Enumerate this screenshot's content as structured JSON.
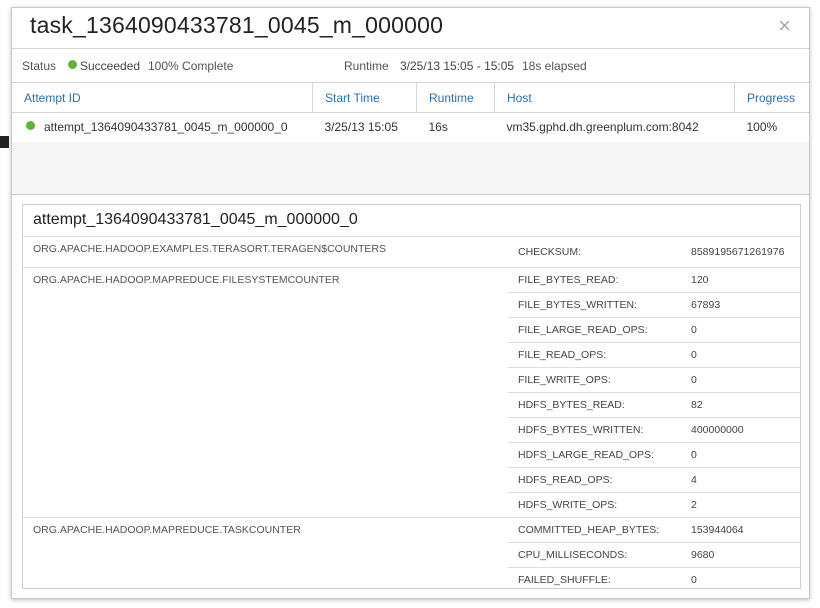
{
  "dialog": {
    "title": "task_1364090433781_0045_m_000000",
    "close_icon": "×"
  },
  "status_bar": {
    "status_label": "Status",
    "status_value": "Succeeded",
    "status_color": "#62b33b",
    "complete": "100% Complete",
    "runtime_label": "Runtime",
    "runtime_range": "3/25/13 15:05 - 15:05",
    "elapsed": "18s elapsed"
  },
  "attempts_table": {
    "headers": [
      "Attempt ID",
      "Start Time",
      "Runtime",
      "Host",
      "Progress"
    ],
    "rows": [
      {
        "attempt_id": "attempt_1364090433781_0045_m_000000_0",
        "start_time": "3/25/13 15:05",
        "runtime": "16s",
        "host": "vm35.gphd.dh.greenplum.com:8042",
        "progress": "100%"
      }
    ]
  },
  "details": {
    "title": "attempt_1364090433781_0045_m_000000_0",
    "groups": [
      {
        "name": "ORG.APACHE.HADOOP.EXAMPLES.TERASORT.TERAGEN$COUNTERS",
        "counters": [
          {
            "name": "CHECKSUM:",
            "value": "8589195671261976"
          }
        ]
      },
      {
        "name": "ORG.APACHE.HADOOP.MAPREDUCE.FILESYSTEMCOUNTER",
        "counters": [
          {
            "name": "FILE_BYTES_READ:",
            "value": "120"
          },
          {
            "name": "FILE_BYTES_WRITTEN:",
            "value": "67893"
          },
          {
            "name": "FILE_LARGE_READ_OPS:",
            "value": "0"
          },
          {
            "name": "FILE_READ_OPS:",
            "value": "0"
          },
          {
            "name": "FILE_WRITE_OPS:",
            "value": "0"
          },
          {
            "name": "HDFS_BYTES_READ:",
            "value": "82"
          },
          {
            "name": "HDFS_BYTES_WRITTEN:",
            "value": "400000000"
          },
          {
            "name": "HDFS_LARGE_READ_OPS:",
            "value": "0"
          },
          {
            "name": "HDFS_READ_OPS:",
            "value": "4"
          },
          {
            "name": "HDFS_WRITE_OPS:",
            "value": "2"
          }
        ]
      },
      {
        "name": "ORG.APACHE.HADOOP.MAPREDUCE.TASKCOUNTER",
        "counters": [
          {
            "name": "COMMITTED_HEAP_BYTES:",
            "value": "153944064"
          },
          {
            "name": "CPU_MILLISECONDS:",
            "value": "9680"
          },
          {
            "name": "FAILED_SHUFFLE:",
            "value": "0"
          }
        ]
      }
    ]
  }
}
